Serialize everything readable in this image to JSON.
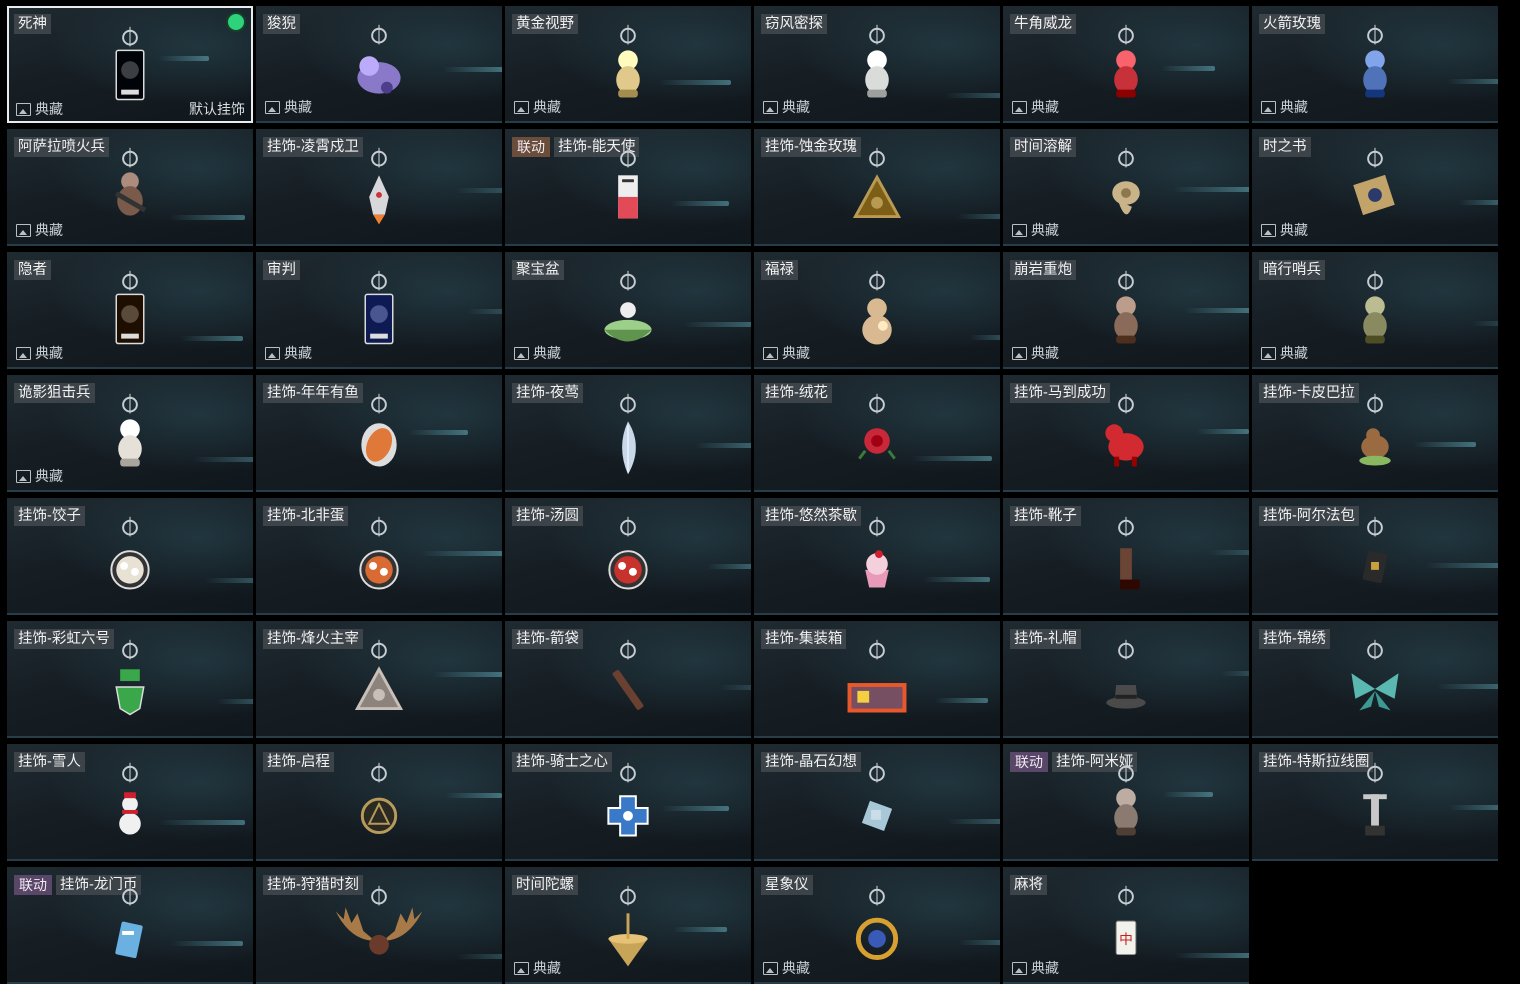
{
  "labels": {
    "rarity": "典藏",
    "default": "默认挂饰"
  },
  "colors": {
    "background": "#000000",
    "card": "#1a2329",
    "tag": "#3c4349",
    "collab": "#5a4668",
    "equipped": "#2ed27a"
  },
  "items": [
    {
      "name": "死神",
      "rarity": true,
      "default": true,
      "equipped": true,
      "selected": true,
      "shape": "card",
      "color": "#3b3f44",
      "icon": "reaper-charm-icon"
    },
    {
      "name": "狻猊",
      "rarity": true,
      "shape": "beast",
      "color": "#8a78c8",
      "icon": "suanni-charm-icon"
    },
    {
      "name": "黄金视野",
      "rarity": true,
      "shape": "figure",
      "color": "#e0c98a",
      "icon": "golden-vision-charm-icon"
    },
    {
      "name": "窃风密探",
      "rarity": true,
      "shape": "figure",
      "color": "#d9dcd8",
      "icon": "wind-spy-charm-icon"
    },
    {
      "name": "牛角威龙",
      "rarity": true,
      "shape": "figure",
      "color": "#c7323a",
      "icon": "horned-dragon-charm-icon"
    },
    {
      "name": "火箭玫瑰",
      "rarity": true,
      "shape": "figure",
      "color": "#4f72b8",
      "icon": "rocket-rose-charm-icon"
    },
    {
      "name": "阿萨拉喷火兵",
      "rarity": true,
      "shape": "soldier",
      "color": "#7a5a4a",
      "icon": "flamethrower-charm-icon"
    },
    {
      "name": "挂饰-凌霄戍卫",
      "shape": "rocket",
      "color": "#d8d8dc",
      "icon": "rocket-charm-icon"
    },
    {
      "name": "挂饰-能天使",
      "collab": "联动",
      "collabAlt": true,
      "shape": "tag",
      "color": "#e24a58",
      "icon": "exusiai-charm-icon"
    },
    {
      "name": "挂饰-蚀金玫瑰",
      "shape": "triangle",
      "color": "#b99a52",
      "icon": "gold-rose-charm-icon"
    },
    {
      "name": "时间溶解",
      "rarity": true,
      "shape": "clock",
      "color": "#c9b48a",
      "icon": "melting-clock-charm-icon"
    },
    {
      "name": "时之书",
      "rarity": true,
      "shape": "book",
      "color": "#c2a46a",
      "icon": "book-charm-icon"
    },
    {
      "name": "隐者",
      "rarity": true,
      "shape": "card",
      "color": "#5a4a3a",
      "icon": "hermit-charm-icon"
    },
    {
      "name": "审判",
      "rarity": true,
      "shape": "card",
      "color": "#4a5690",
      "icon": "judgement-charm-icon"
    },
    {
      "name": "聚宝盆",
      "rarity": true,
      "shape": "bowl",
      "color": "#9ccf8a",
      "icon": "treasure-bowl-charm-icon"
    },
    {
      "name": "福禄",
      "rarity": true,
      "shape": "gourd",
      "color": "#d9b991",
      "icon": "gourd-charm-icon"
    },
    {
      "name": "崩岩重炮",
      "rarity": true,
      "shape": "figure",
      "color": "#8a6a58",
      "icon": "heavy-gunner-charm-icon"
    },
    {
      "name": "暗行哨兵",
      "rarity": true,
      "shape": "figure",
      "color": "#8a8a60",
      "icon": "sentinel-charm-icon"
    },
    {
      "name": "诡影狙击兵",
      "rarity": true,
      "shape": "figure",
      "color": "#e5e0d8",
      "icon": "sniper-charm-icon"
    },
    {
      "name": "挂饰-年年有鱼",
      "shape": "fish",
      "color": "#e0783a",
      "icon": "fish-charm-icon"
    },
    {
      "name": "挂饰-夜莺",
      "shape": "feather",
      "color": "#c8d8ea",
      "icon": "feather-charm-icon"
    },
    {
      "name": "挂饰-绒花",
      "shape": "flower",
      "color": "#c8283a",
      "icon": "flower-charm-icon"
    },
    {
      "name": "挂饰-马到成功",
      "shape": "horse",
      "color": "#d22a30",
      "icon": "horse-charm-icon"
    },
    {
      "name": "挂饰-卡皮巴拉",
      "shape": "capybara",
      "color": "#9a6a40",
      "icon": "capybara-charm-icon"
    },
    {
      "name": "挂饰-饺子",
      "shape": "plate",
      "color": "#e8e2d4",
      "icon": "dumpling-charm-icon"
    },
    {
      "name": "挂饰-北非蛋",
      "shape": "plate",
      "color": "#d86a32",
      "icon": "shakshuka-charm-icon"
    },
    {
      "name": "挂饰-汤圆",
      "shape": "plate",
      "color": "#c8322c",
      "icon": "tangyuan-charm-icon"
    },
    {
      "name": "挂饰-悠然茶歇",
      "shape": "cupcake",
      "color": "#e89ab8",
      "icon": "cupcake-charm-icon"
    },
    {
      "name": "挂饰-靴子",
      "shape": "boot",
      "color": "#6a4434",
      "icon": "boot-charm-icon"
    },
    {
      "name": "挂饰-阿尔法包",
      "shape": "bag",
      "color": "#2a2a2a",
      "icon": "alpha-bag-charm-icon"
    },
    {
      "name": "挂饰-彩虹六号",
      "shape": "shield",
      "color": "#3aa84a",
      "icon": "rainbow-six-charm-icon"
    },
    {
      "name": "挂饰-烽火主宰",
      "shape": "triangle",
      "color": "#c8c0b8",
      "icon": "warlord-charm-icon"
    },
    {
      "name": "挂饰-箭袋",
      "shape": "quiver",
      "color": "#6a4030",
      "icon": "quiver-charm-icon"
    },
    {
      "name": "挂饰-集装箱",
      "shape": "container",
      "color": "#e8582a",
      "icon": "container-charm-icon"
    },
    {
      "name": "挂饰-礼帽",
      "shape": "hat",
      "color": "#4a4a4a",
      "icon": "top-hat-charm-icon"
    },
    {
      "name": "挂饰-锦绣",
      "shape": "butterfly",
      "color": "#5ab8b0",
      "icon": "butterfly-charm-icon"
    },
    {
      "name": "挂饰-雪人",
      "shape": "snowman",
      "color": "#f0f0f0",
      "icon": "snowman-charm-icon"
    },
    {
      "name": "挂饰-启程",
      "shape": "medal",
      "color": "#b89a5a",
      "icon": "medal-charm-icon"
    },
    {
      "name": "挂饰-骑士之心",
      "shape": "cross",
      "color": "#3a78c8",
      "icon": "knight-heart-charm-icon"
    },
    {
      "name": "挂饰-晶石幻想",
      "shape": "cube",
      "color": "#a8c8d8",
      "icon": "crystal-charm-icon"
    },
    {
      "name": "挂饰-阿米娅",
      "collab": "联动",
      "shape": "figure",
      "color": "#8a7a70",
      "icon": "amiya-charm-icon"
    },
    {
      "name": "挂饰-特斯拉线圈",
      "shape": "tower",
      "color": "#c8c8c8",
      "icon": "tesla-coil-charm-icon"
    },
    {
      "name": "挂饰-龙门币",
      "collab": "联动",
      "shape": "coin-card",
      "color": "#6ab0e0",
      "icon": "lungmen-coin-charm-icon"
    },
    {
      "name": "挂饰-狩猎时刻",
      "shape": "antlers",
      "color": "#a87a48",
      "icon": "antlers-charm-icon"
    },
    {
      "name": "时间陀螺",
      "rarity": true,
      "shape": "top",
      "color": "#c8a458",
      "icon": "spinning-top-charm-icon"
    },
    {
      "name": "星象仪",
      "rarity": true,
      "shape": "astrolabe",
      "color": "#d8a030",
      "icon": "astrolabe-charm-icon"
    },
    {
      "name": "麻将",
      "rarity": true,
      "shape": "tile",
      "color": "#f2f2ec",
      "icon": "mahjong-charm-icon"
    }
  ]
}
